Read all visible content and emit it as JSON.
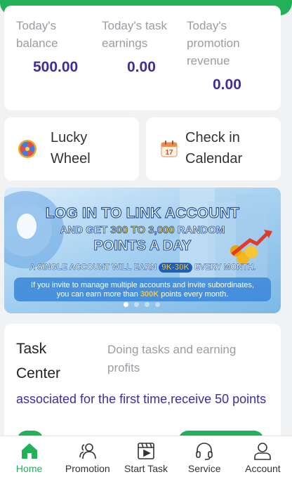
{
  "colors": {
    "accent": "#22b158",
    "value_text": "#3d2f9a",
    "muted_text": "#9a9ca3"
  },
  "stats": [
    {
      "label": "Today's balance",
      "value": "500.00"
    },
    {
      "label": "Today's task earnings",
      "value": "0.00"
    },
    {
      "label": "Today's promotion revenue",
      "value": "0.00"
    }
  ],
  "shortcuts": {
    "lucky_wheel": {
      "label_line1": "Lucky",
      "label_line2": "Wheel",
      "icon": "wheel-icon"
    },
    "check_in": {
      "label_line1": "Check in",
      "label_line2": "Calendar",
      "icon": "calendar-icon"
    }
  },
  "banner": {
    "line1": "LOG IN TO LINK ACCOUNT",
    "line2_pre": "AND GET ",
    "line2_hl": "300 TO 3,000",
    "line2_post": " RANDOM",
    "line3": "POINTS A DAY",
    "line4_pre": "A SINGLE ACCOUNT WILL EARN ",
    "line4_hl": "9K-30K",
    "line4_post": " EVERY MONTH.",
    "note_line1": "If you invite to manage multiple accounts and invite subordinates,",
    "note_line2_pre": "you can earn more than ",
    "note_line2_hl": "300K",
    "note_line2_post": " points every month.",
    "active_slide": 1,
    "slide_count": 4
  },
  "task_center": {
    "title_line1": "Task",
    "title_line2": "Center",
    "subtitle": "Doing tasks and earning profits",
    "description": "associated for the first time,receive 50 points"
  },
  "tabbar": [
    {
      "label": "Home",
      "icon": "home-icon",
      "active": true
    },
    {
      "label": "Promotion",
      "icon": "people-icon",
      "active": false
    },
    {
      "label": "Start Task",
      "icon": "video-icon",
      "active": false
    },
    {
      "label": "Service",
      "icon": "headset-icon",
      "active": false
    },
    {
      "label": "Account",
      "icon": "user-icon",
      "active": false
    }
  ]
}
